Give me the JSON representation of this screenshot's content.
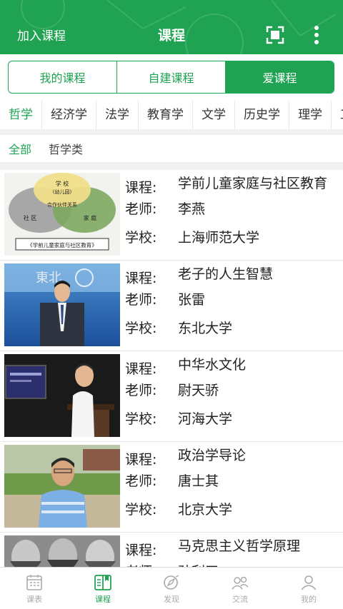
{
  "header": {
    "left_action": "加入课程",
    "title": "课程"
  },
  "segments": [
    "我的课程",
    "自建课程",
    "爱课程"
  ],
  "categories": [
    "哲学",
    "经济学",
    "法学",
    "教育学",
    "文学",
    "历史学",
    "理学",
    "工"
  ],
  "subcategories": [
    "全部",
    "哲学类"
  ],
  "field_labels": {
    "course": "课程:",
    "teacher": "老师:",
    "school": "学校:"
  },
  "thumb1_text": {
    "top": "学 校",
    "top2": "(幼儿园)",
    "mid": "合作伙伴关系",
    "left": "社 区",
    "right": "家 庭",
    "caption": "《学前儿童家庭与社区教育》"
  },
  "courses": [
    {
      "course": "学前儿童家庭与社区教育",
      "teacher": "李燕",
      "school": "上海师范大学"
    },
    {
      "course": "老子的人生智慧",
      "teacher": "张雷",
      "school": "东北大学"
    },
    {
      "course": "中华水文化",
      "teacher": "尉天骄",
      "school": "河海大学"
    },
    {
      "course": "政治学导论",
      "teacher": "唐士其",
      "school": "北京大学"
    },
    {
      "course": "马克思主义哲学原理",
      "teacher": "孙利天",
      "school": ""
    }
  ],
  "tabs": [
    "课表",
    "课程",
    "发现",
    "交流",
    "我的"
  ],
  "colors": {
    "accent": "#1fa352"
  }
}
